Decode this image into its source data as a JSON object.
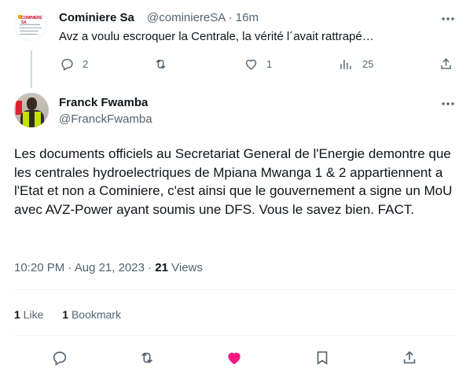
{
  "parent_tweet": {
    "author_name": "Cominiere Sa",
    "handle_time": "@cominiereSA · 16m",
    "text": "Avz a voulu escroquer la Centrale, la vérité l´avait rattrapé…",
    "replies": "2",
    "likes": "1",
    "views": "25"
  },
  "main_tweet": {
    "author_name": "Franck Fwamba",
    "handle": "@FranckFwamba",
    "text": "Les documents officiels au Secretariat General de l'Energie demontre que les centrales hydroelectriques de Mpiana Mwanga 1 & 2 appartiennent a l'Etat et non a Cominiere, c'est ainsi que le gouvernement a signe un MoU avec AVZ-Power ayant soumis une DFS. Vous le savez bien. FACT.",
    "timestamp": "10:20 PM · Aug 21, 2023 · ",
    "views_count": "21",
    "views_label": " Views",
    "likes_count": "1",
    "likes_label": " Like",
    "bookmarks_count": "1",
    "bookmarks_label": " Bookmark"
  },
  "colors": {
    "text": "#0f1419",
    "muted": "#536471",
    "like_active": "#f91880",
    "divider": "#eff3f4"
  }
}
